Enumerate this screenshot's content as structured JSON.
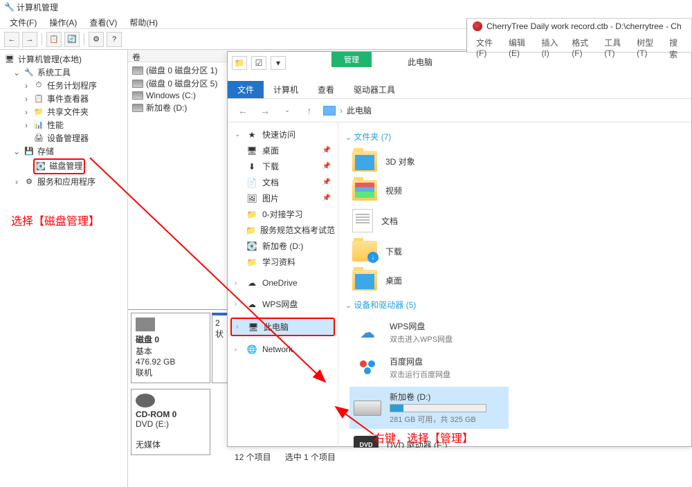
{
  "mgmt": {
    "title": "计算机管理",
    "menu": [
      "文件(F)",
      "操作(A)",
      "查看(V)",
      "帮助(H)"
    ],
    "tree": {
      "root": "计算机管理(本地)",
      "system_tools": "系统工具",
      "task_scheduler": "任务计划程序",
      "event_viewer": "事件查看器",
      "shared_folders": "共享文件夹",
      "performance": "性能",
      "device_mgr": "设备管理器",
      "storage": "存储",
      "disk_mgmt": "磁盘管理",
      "services": "服务和应用程序"
    },
    "vol_header": "卷",
    "volumes": [
      "(磁盘 0 磁盘分区 1)",
      "(磁盘 0 磁盘分区 5)",
      "Windows (C:)",
      "新加卷 (D:)"
    ],
    "disk0": {
      "name": "磁盘 0",
      "type": "基本",
      "size": "476.92 GB",
      "status": "联机"
    },
    "cdrom": {
      "name": "CD-ROM 0",
      "drive": "DVD (E:)",
      "status": "无媒体"
    }
  },
  "explorer": {
    "manage_tab": "管理",
    "this_pc_tab": "此电脑",
    "tabs": {
      "file": "文件",
      "computer": "计算机",
      "view": "查看",
      "drive_tools": "驱动器工具"
    },
    "breadcrumb": "此电脑",
    "nav": {
      "quick_access": "快速访问",
      "desktop": "桌面",
      "downloads": "下载",
      "documents": "文档",
      "pictures": "图片",
      "study0": "0-对接学习",
      "spec": "服务规范文档考试范",
      "newvol": "新加卷 (D:)",
      "study": "学习资料",
      "onedrive": "OneDrive",
      "wps": "WPS网盘",
      "this_pc": "此电脑",
      "network": "Network"
    },
    "sections": {
      "folders": "文件夹 (7)",
      "devices": "设备和驱动器 (5)"
    },
    "folders": {
      "3d": "3D 对象",
      "video": "视频",
      "docs": "文档",
      "downloads": "下载",
      "desktop": "桌面"
    },
    "drives": {
      "wps": {
        "name": "WPS网盘",
        "sub": "双击进入WPS网盘"
      },
      "baidu": {
        "name": "百度网盘",
        "sub": "双击运行百度网盘"
      },
      "d": {
        "name": "新加卷 (D:)",
        "sub": "281 GB 可用，共 325 GB"
      },
      "dvd": {
        "name": "DVD 驱动器 (E:)"
      }
    },
    "status": {
      "count": "12 个项目",
      "selected": "选中 1 个项目"
    }
  },
  "cherry": {
    "title": "CherryTree  Daily work record.ctb - D:\\cherrytree - Ch",
    "menu": [
      "文件(F)",
      "编辑(E)",
      "插入(I)",
      "格式(F)",
      "工具(T)",
      "树型(T)",
      "搜索"
    ]
  },
  "annotations": {
    "select_disk": "选择【磁盘管理】",
    "right_click": "右键，选择【管理】"
  }
}
